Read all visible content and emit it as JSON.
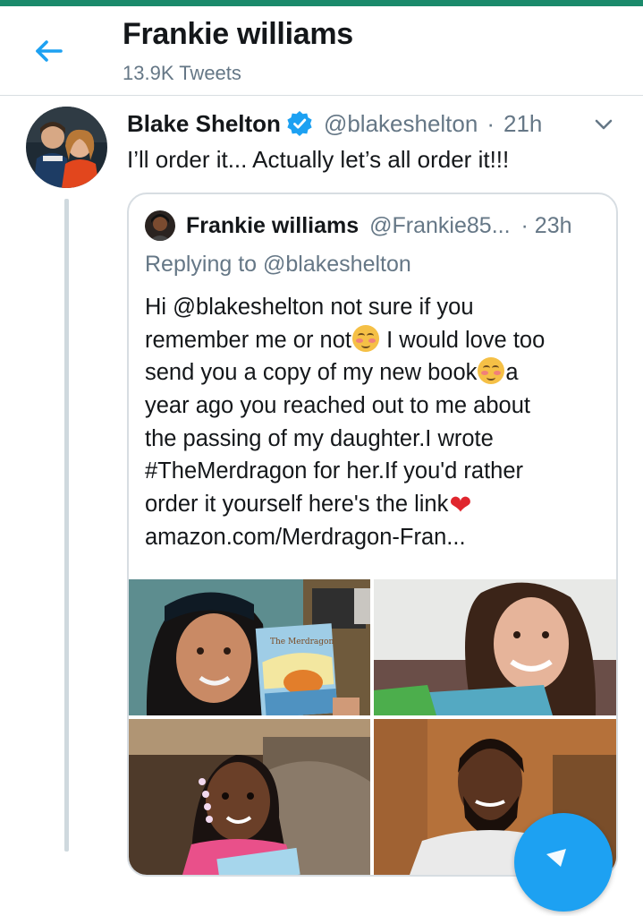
{
  "header": {
    "title": "Frankie williams",
    "subtitle": "13.9K Tweets"
  },
  "tweet": {
    "name": "Blake Shelton",
    "handle": "@blakeshelton",
    "separator": "·",
    "time": "21h",
    "text": "I’ll order it... Actually let’s all order it!!!"
  },
  "quoted": {
    "name": "Frankie williams",
    "handle": "@Frankie85...",
    "time": "· 23h",
    "replying": "Replying to @blakeshelton",
    "lines": [
      {
        "parts": [
          "Hi @blakeshelton not sure if you"
        ]
      },
      {
        "parts": [
          "remember me or not",
          " I would love too"
        ]
      },
      {
        "parts": [
          "send you a copy of my new book",
          "a"
        ]
      },
      {
        "parts": [
          "year ago you reached out to me about"
        ]
      },
      {
        "parts": [
          "the passing of my daughter.I wrote"
        ]
      },
      {
        "parts": [
          "#TheMerdragon for her.If you'd rather"
        ]
      },
      {
        "parts": [
          "order it yourself here's the link"
        ]
      },
      {
        "parts": [
          "amazon.com/Merdragon-Fran..."
        ]
      }
    ],
    "emojis": [
      "smiling-blush-emoji",
      "smiling-blush-emoji",
      "red-heart-emoji"
    ],
    "book_cover_text": "The Merdragon"
  },
  "colors": {
    "accent": "#1da1f2",
    "statusbar": "#1b8a6b",
    "secondary_text": "#657786",
    "heart": "#e0262e"
  }
}
